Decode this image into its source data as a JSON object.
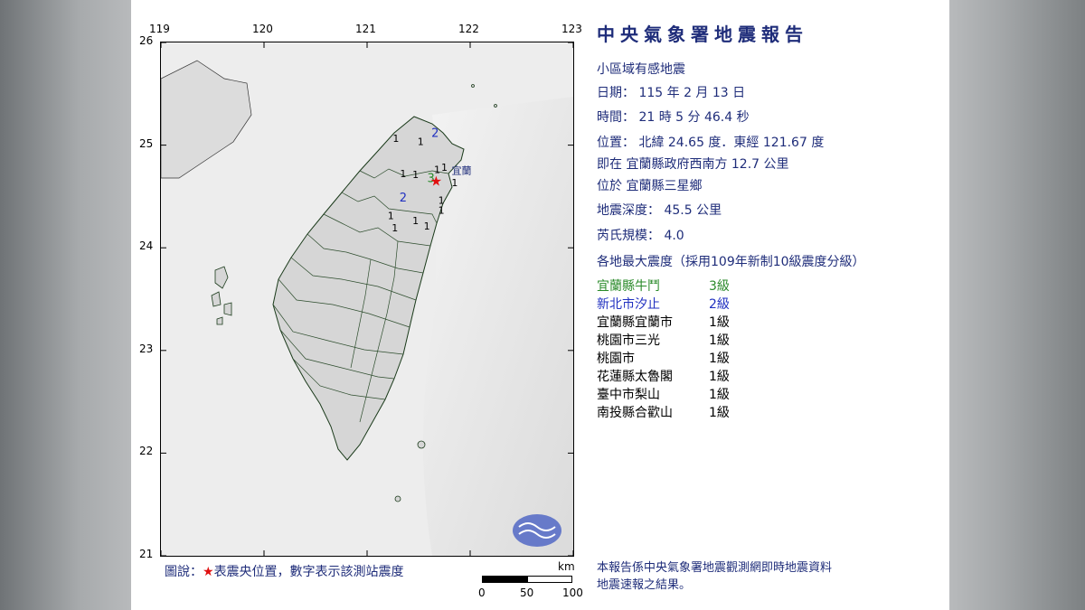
{
  "report": {
    "title": "中央氣象署地震報告",
    "type_line": "小區域有感地震",
    "date_line": "日期： 115 年 2 月 13 日",
    "time_line": "時間： 21 時 5 分 46.4 秒",
    "location_line": "位置： 北緯 24.65 度．東經 121.67 度",
    "relative_line": "即在 宜蘭縣政府西南方 12.7 公里",
    "town_line": "位於 宜蘭縣三星鄉",
    "depth_line": "地震深度： 45.5 公里",
    "magnitude_line": "芮氏規模： 4.0",
    "intensity_header": "各地最大震度（採用109年新制10級震度分級）"
  },
  "stations": [
    {
      "name": "宜蘭縣牛鬥",
      "level": "3級",
      "color": "#2a8a2a"
    },
    {
      "name": "新北市汐止",
      "level": "2級",
      "color": "#2030c0"
    },
    {
      "name": "宜蘭縣宜蘭市",
      "level": "1級",
      "color": "#000000"
    },
    {
      "name": "桃園市三光",
      "level": "1級",
      "color": "#000000"
    },
    {
      "name": "桃園市",
      "level": "1級",
      "color": "#000000"
    },
    {
      "name": "花蓮縣太魯閣",
      "level": "1級",
      "color": "#000000"
    },
    {
      "name": "臺中市梨山",
      "level": "1級",
      "color": "#000000"
    },
    {
      "name": "南投縣合歡山",
      "level": "1級",
      "color": "#000000"
    }
  ],
  "map": {
    "lon_ticks": [
      "119",
      "120",
      "121",
      "122",
      "123"
    ],
    "lat_ticks": [
      "26",
      "25",
      "24",
      "23",
      "22",
      "21"
    ],
    "city_label": "宜蘭",
    "epicenter": {
      "lat": 24.65,
      "lon": 121.67
    },
    "intensity_marks": [
      {
        "text": "3",
        "lon": 121.62,
        "lat": 24.64,
        "color": "#2a8a2a"
      },
      {
        "text": "2",
        "lon": 121.66,
        "lat": 25.08,
        "color": "#2030c0"
      },
      {
        "text": "2",
        "lon": 121.35,
        "lat": 24.45,
        "color": "#2030c0"
      },
      {
        "text": "1",
        "lon": 121.75,
        "lat": 24.75,
        "color": "#000000"
      },
      {
        "text": "1",
        "lon": 121.68,
        "lat": 24.73,
        "color": "#000000"
      },
      {
        "text": "1",
        "lon": 121.47,
        "lat": 24.68,
        "color": "#000000"
      },
      {
        "text": "1",
        "lon": 121.35,
        "lat": 24.69,
        "color": "#000000"
      },
      {
        "text": "1",
        "lon": 121.28,
        "lat": 25.03,
        "color": "#000000"
      },
      {
        "text": "1",
        "lon": 121.52,
        "lat": 25.0,
        "color": "#000000"
      },
      {
        "text": "1",
        "lon": 121.85,
        "lat": 24.6,
        "color": "#000000"
      },
      {
        "text": "1",
        "lon": 121.72,
        "lat": 24.43,
        "color": "#000000"
      },
      {
        "text": "1",
        "lon": 121.72,
        "lat": 24.33,
        "color": "#000000"
      },
      {
        "text": "1",
        "lon": 121.23,
        "lat": 24.28,
        "color": "#000000"
      },
      {
        "text": "1",
        "lon": 121.27,
        "lat": 24.16,
        "color": "#000000"
      },
      {
        "text": "1",
        "lon": 121.47,
        "lat": 24.23,
        "color": "#000000"
      },
      {
        "text": "1",
        "lon": 121.58,
        "lat": 24.18,
        "color": "#000000"
      }
    ]
  },
  "legend": {
    "prefix": "圖說：",
    "star": "★",
    "text": "表震央位置，數字表示該測站震度"
  },
  "scale": {
    "unit": "km",
    "labels": [
      "0",
      "50",
      "100"
    ]
  },
  "note": {
    "line1": "本報告係中央氣象署地震觀測網即時地震資料",
    "line2": "地震速報之結果。"
  },
  "colors": {
    "title": "#1f2d7a",
    "epicenter": "#e01010",
    "sea": "#ececec",
    "land": "#d8d8d8"
  }
}
